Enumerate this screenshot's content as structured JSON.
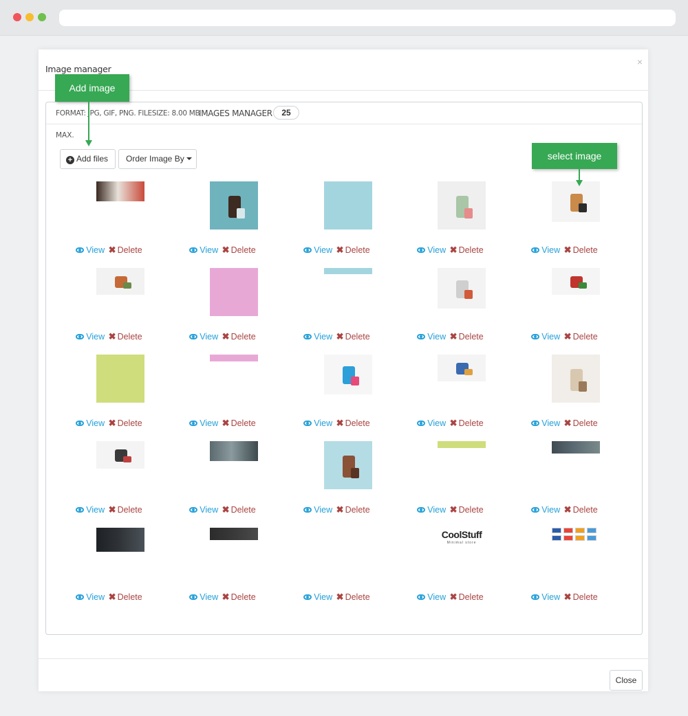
{
  "modal": {
    "title": "Image manager",
    "close_glyph": "×",
    "format_text": "FORMAT: JPG, GIF, PNG. FILESIZE: 8.00 MB",
    "max_text": "MAX.",
    "manager_title": "IMAGES MANAGER",
    "count": "25",
    "add_files_label": "Add files",
    "order_label": "Order Image By",
    "close_button_label": "Close"
  },
  "callouts": {
    "add_image": "Add image",
    "select_image": "select image"
  },
  "actions": {
    "view": "View",
    "delete": "Delete"
  },
  "images": [
    {
      "name": "sale-banner-red",
      "kind": "banner",
      "colors": [
        "#3a2a22",
        "#c94a3a",
        "#e8e2da"
      ]
    },
    {
      "name": "vase-chair",
      "kind": "photo",
      "colors": [
        "#6fb3bd",
        "#3d2a20",
        "#d9e8ea"
      ]
    },
    {
      "name": "light-blue-square",
      "kind": "solid",
      "colors": [
        "#a3d5df"
      ]
    },
    {
      "name": "tree-decal",
      "kind": "photo",
      "colors": [
        "#efefef",
        "#a9c6a6",
        "#e78b8b"
      ]
    },
    {
      "name": "watch-box",
      "kind": "photo",
      "colors": [
        "#f4f4f4",
        "#c98a4a",
        "#2c2c2c"
      ]
    },
    {
      "name": "plant-pot",
      "kind": "photo",
      "colors": [
        "#f2f2f2",
        "#c56a36",
        "#6a8a4a"
      ]
    },
    {
      "name": "pink-square",
      "kind": "solid",
      "colors": [
        "#e8a8d6"
      ]
    },
    {
      "name": "light-blue-bar",
      "kind": "solid",
      "colors": [
        "#a3d5df"
      ]
    },
    {
      "name": "wall-clock",
      "kind": "photo",
      "colors": [
        "#f3f3f3",
        "#cfcfcf",
        "#d15a3a"
      ]
    },
    {
      "name": "toy-car",
      "kind": "photo",
      "colors": [
        "#f5f5f5",
        "#c0352d",
        "#3a8a3a"
      ]
    },
    {
      "name": "lime-square",
      "kind": "solid",
      "colors": [
        "#cfdd7c"
      ]
    },
    {
      "name": "pink-bar",
      "kind": "solid",
      "colors": [
        "#e8a8d6"
      ]
    },
    {
      "name": "bottles-podium",
      "kind": "photo",
      "colors": [
        "#f6f6f6",
        "#2d9fd9",
        "#e84a7a"
      ]
    },
    {
      "name": "candles",
      "kind": "photo",
      "colors": [
        "#f4f4f4",
        "#3a6ab0",
        "#e0a040"
      ]
    },
    {
      "name": "hat-bag",
      "kind": "photo",
      "colors": [
        "#f1ede8",
        "#d8c8b0",
        "#9a7a5a"
      ]
    },
    {
      "name": "lens",
      "kind": "photo",
      "colors": [
        "#f4f4f4",
        "#3a3a3a",
        "#c04040"
      ]
    },
    {
      "name": "sofa-banner",
      "kind": "banner",
      "colors": [
        "#5a6a6e",
        "#3e4a4d",
        "#8a9a9e"
      ]
    },
    {
      "name": "wooden-tags",
      "kind": "photo",
      "colors": [
        "#b4dce4",
        "#8a5236",
        "#5a3422"
      ]
    },
    {
      "name": "lime-bar",
      "kind": "solid",
      "colors": [
        "#cfdd7c"
      ]
    },
    {
      "name": "interior-strip",
      "kind": "banner",
      "colors": [
        "#3f4a52",
        "#7a8a8a",
        "#5a6a72"
      ]
    },
    {
      "name": "dark-room",
      "kind": "banner",
      "colors": [
        "#1e2226",
        "#4a5258",
        "#2e3236"
      ]
    },
    {
      "name": "dark-strip",
      "kind": "banner",
      "colors": [
        "#2c2c2c",
        "#4a4a4a",
        "#383838"
      ]
    },
    {
      "name": "empty",
      "kind": "empty",
      "colors": []
    },
    {
      "name": "coolstuff-logo",
      "kind": "logo",
      "colors": [
        "#222222"
      ],
      "logo_text": "CoolStuff",
      "logo_sub": "Minimal store"
    },
    {
      "name": "payment-cards",
      "kind": "cards",
      "colors": [
        "#2a5caa",
        "#e8443a",
        "#f0a020",
        "#4a9ad9"
      ]
    }
  ]
}
